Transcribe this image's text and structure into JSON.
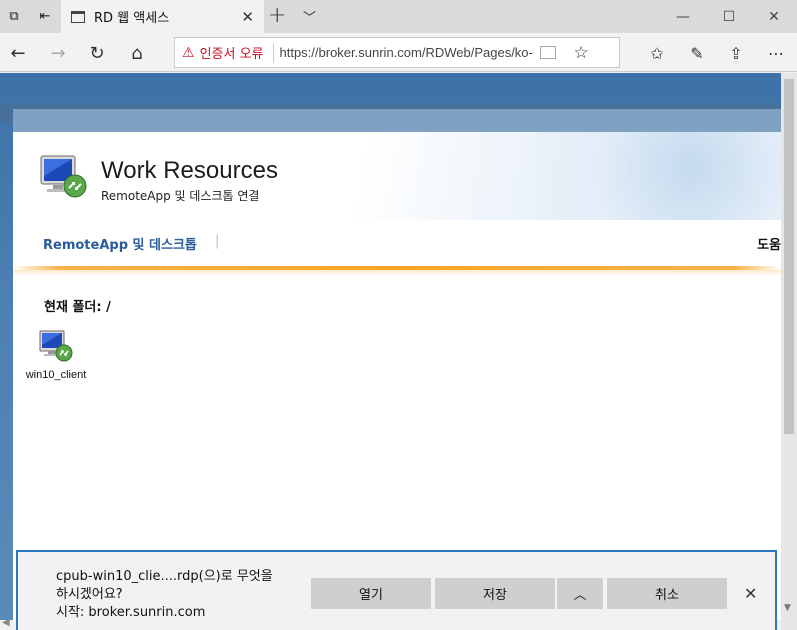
{
  "browser": {
    "tab": {
      "title": "RD 웹 액세스"
    },
    "address": {
      "cert_warning": "인증서 오류",
      "url": "https://broker.sunrin.com/RDWeb/Pages/ko-KR/Default.aspx"
    }
  },
  "page": {
    "title": "Work Resources",
    "subtitle": "RemoteApp 및 데스크톱 연결",
    "nav_link": "RemoteApp 및 데스크톱",
    "nav_separator": "|",
    "help": "도움",
    "current_folder": "현재 폴더: /",
    "resources": [
      {
        "label": "win10_client"
      }
    ]
  },
  "download_bar": {
    "message_line1": "cpub-win10_clie....rdp(으)로 무엇을",
    "message_line2": "하시겠어요?",
    "source": "시작: broker.sunrin.com",
    "open": "열기",
    "save": "저장",
    "cancel": "취소"
  },
  "colors": {
    "accent": "#2b78c2",
    "nav_link": "#2a5d99",
    "warning": "#c50f1f",
    "header_line": "#f5a623"
  }
}
